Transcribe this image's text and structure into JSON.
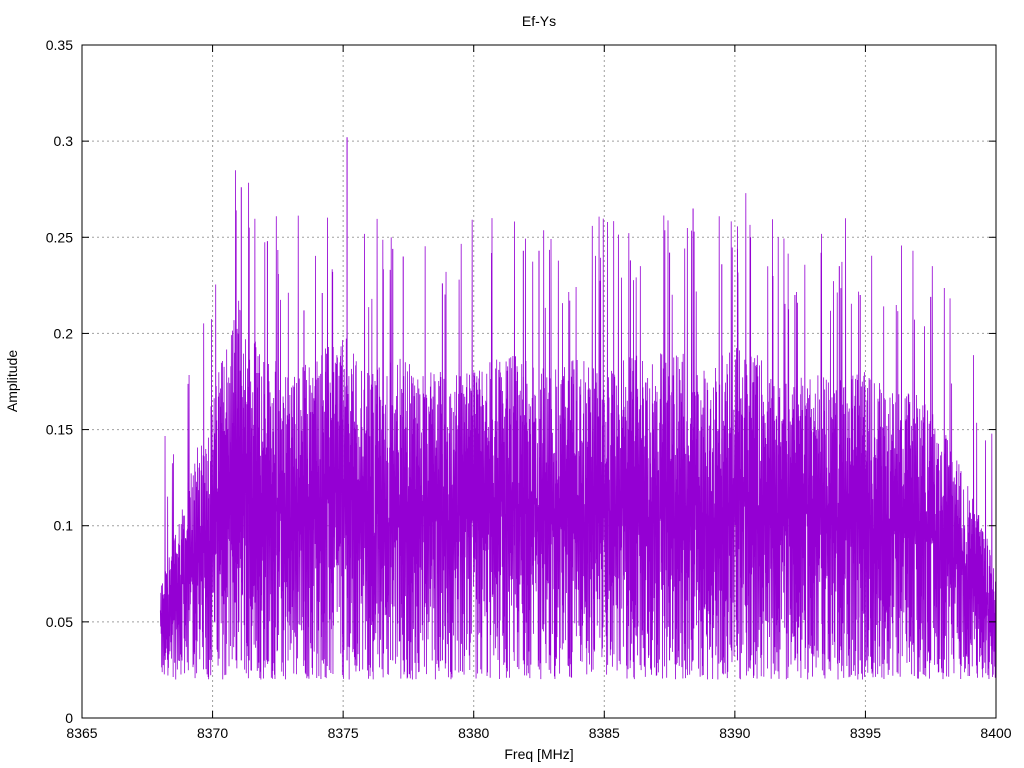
{
  "chart_data": {
    "type": "line",
    "title": "Ef-Ys",
    "xlabel": "Freq [MHz]",
    "ylabel": "Amplitude",
    "xlim": [
      8365,
      8400
    ],
    "ylim": [
      0,
      0.35
    ],
    "x_ticks": [
      "8365",
      "8370",
      "8375",
      "8380",
      "8385",
      "8390",
      "8395",
      "8400"
    ],
    "y_ticks": [
      "0",
      "0.05",
      "0.1",
      "0.15",
      "0.2",
      "0.25",
      "0.3",
      "0.35"
    ],
    "grid": true,
    "legend": "none",
    "line_color": "#9400d3",
    "series": [
      {
        "x_start": 8368.0,
        "x_end": 8400.0,
        "envelope": {
          "x": [
            8368.0,
            8369.0,
            8370.0,
            8371.0,
            8372.0,
            8373.0,
            8374.0,
            8375.0,
            8376.0,
            8377.0,
            8378.0,
            8379.0,
            8380.0,
            8381.0,
            8382.0,
            8383.0,
            8384.0,
            8385.0,
            8386.0,
            8387.0,
            8388.0,
            8389.0,
            8390.0,
            8391.0,
            8392.0,
            8393.0,
            8394.0,
            8395.0,
            8396.0,
            8397.0,
            8398.0,
            8399.0,
            8400.0
          ],
          "upper": [
            0.07,
            0.12,
            0.17,
            0.22,
            0.19,
            0.18,
            0.19,
            0.2,
            0.18,
            0.19,
            0.18,
            0.18,
            0.18,
            0.19,
            0.19,
            0.18,
            0.19,
            0.18,
            0.19,
            0.19,
            0.19,
            0.18,
            0.2,
            0.19,
            0.18,
            0.18,
            0.18,
            0.18,
            0.17,
            0.17,
            0.15,
            0.12,
            0.08
          ],
          "lower": [
            0.02,
            0.02,
            0.02,
            0.02,
            0.02,
            0.02,
            0.02,
            0.02,
            0.02,
            0.02,
            0.02,
            0.02,
            0.02,
            0.02,
            0.02,
            0.02,
            0.02,
            0.02,
            0.02,
            0.02,
            0.02,
            0.02,
            0.02,
            0.02,
            0.02,
            0.02,
            0.02,
            0.02,
            0.02,
            0.02,
            0.02,
            0.02,
            0.02
          ]
        },
        "peaks": [
          {
            "x": 8370.9,
            "y": 0.264
          },
          {
            "x": 8371.1,
            "y": 0.276
          },
          {
            "x": 8371.4,
            "y": 0.255
          },
          {
            "x": 8372.1,
            "y": 0.248
          },
          {
            "x": 8373.5,
            "y": 0.212
          },
          {
            "x": 8374.2,
            "y": 0.221
          },
          {
            "x": 8375.15,
            "y": 0.302
          },
          {
            "x": 8376.9,
            "y": 0.244
          },
          {
            "x": 8377.3,
            "y": 0.24
          },
          {
            "x": 8378.8,
            "y": 0.226
          },
          {
            "x": 8381.9,
            "y": 0.243
          },
          {
            "x": 8382.5,
            "y": 0.243
          },
          {
            "x": 8386.0,
            "y": 0.238
          },
          {
            "x": 8387.5,
            "y": 0.242
          },
          {
            "x": 8388.4,
            "y": 0.265
          },
          {
            "x": 8389.5,
            "y": 0.236
          },
          {
            "x": 8390.1,
            "y": 0.244
          },
          {
            "x": 8390.6,
            "y": 0.25
          },
          {
            "x": 8392.3,
            "y": 0.22
          },
          {
            "x": 8394.0,
            "y": 0.235
          },
          {
            "x": 8394.8,
            "y": 0.22
          },
          {
            "x": 8397.5,
            "y": 0.219
          }
        ]
      }
    ]
  }
}
